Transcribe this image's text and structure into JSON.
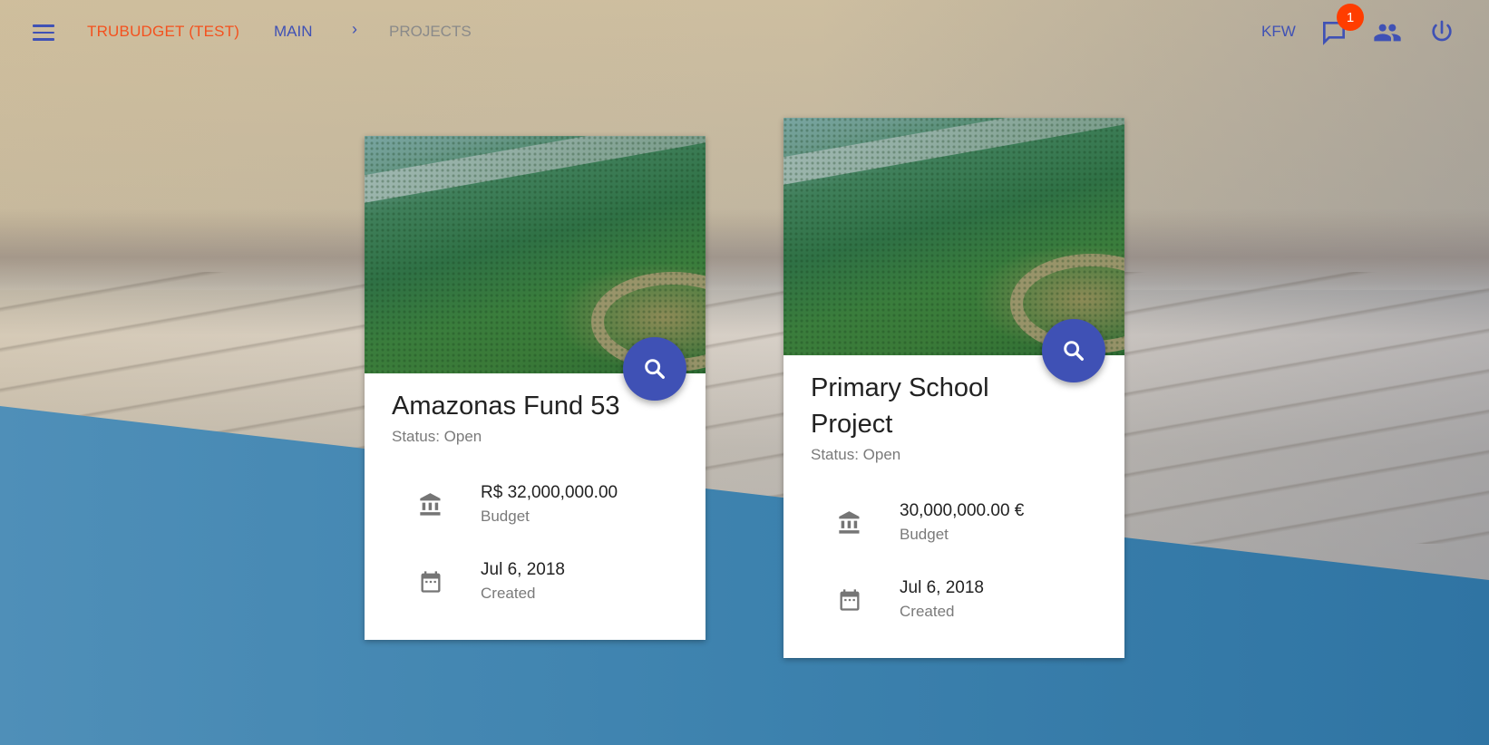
{
  "header": {
    "brand": "TRUBUDGET (TEST)",
    "breadcrumb": {
      "main": "MAIN",
      "separator": "›",
      "current": "PROJECTS"
    },
    "organization": "KFW",
    "notification_count": "1"
  },
  "projects": [
    {
      "title": "Amazonas Fund 53",
      "status": "Status: Open",
      "budget_value": "R$ 32,000,000.00",
      "budget_label": "Budget",
      "created_value": "Jul 6, 2018",
      "created_label": "Created"
    },
    {
      "title": "Primary School Project",
      "status": "Status: Open",
      "budget_value": "30,000,000.00 €",
      "budget_label": "Budget",
      "created_value": "Jul 6, 2018",
      "created_label": "Created"
    }
  ],
  "colors": {
    "primary": "#3f51b5",
    "brand": "#f4511e",
    "badge": "#ff3d00"
  },
  "icons": [
    "menu-icon",
    "chat-icon",
    "people-icon",
    "power-icon",
    "search-icon",
    "bank-icon",
    "calendar-icon"
  ]
}
